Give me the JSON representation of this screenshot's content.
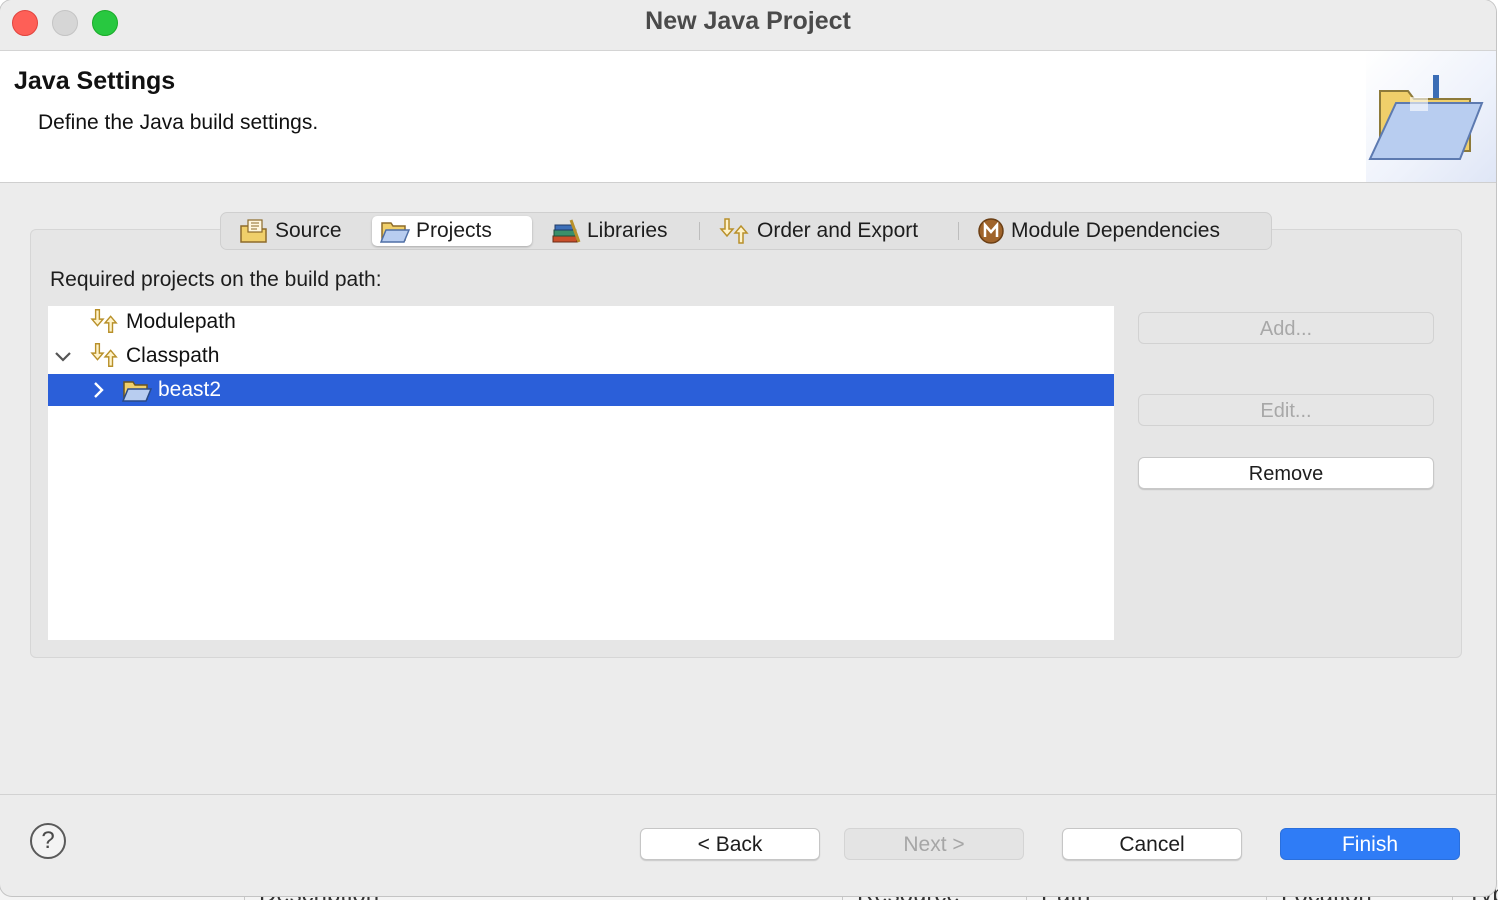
{
  "window": {
    "title": "New Java Project"
  },
  "header": {
    "title": "Java Settings",
    "description": "Define the Java build settings."
  },
  "tabs": [
    {
      "label": "Source",
      "icon": "source-folder-icon",
      "selected": false
    },
    {
      "label": "Projects",
      "icon": "open-folder-icon",
      "selected": true
    },
    {
      "label": "Libraries",
      "icon": "libraries-icon",
      "selected": false
    },
    {
      "label": "Order and Export",
      "icon": "order-arrows-icon",
      "selected": false
    },
    {
      "label": "Module Dependencies",
      "icon": "module-icon",
      "selected": false
    }
  ],
  "projects": {
    "label": "Required projects on the build path:",
    "tree": [
      {
        "label": "Modulepath",
        "icon": "order-arrows-icon",
        "expanded": false
      },
      {
        "label": "Classpath",
        "icon": "order-arrows-icon",
        "expanded": true
      },
      {
        "label": "beast2",
        "icon": "project-folder-icon",
        "expanded": false,
        "selected": true
      }
    ],
    "buttons": {
      "add": "Add...",
      "edit": "Edit...",
      "remove": "Remove"
    }
  },
  "footer": {
    "back": "< Back",
    "next": "Next >",
    "cancel": "Cancel",
    "finish": "Finish"
  },
  "background_columns": [
    "Description",
    "Resource",
    "Path",
    "Location",
    "Typ"
  ],
  "colors": {
    "selection": "#2b5fd9",
    "primary_button": "#2f7cf6",
    "close": "#fe5f57",
    "maximize": "#28c840"
  }
}
